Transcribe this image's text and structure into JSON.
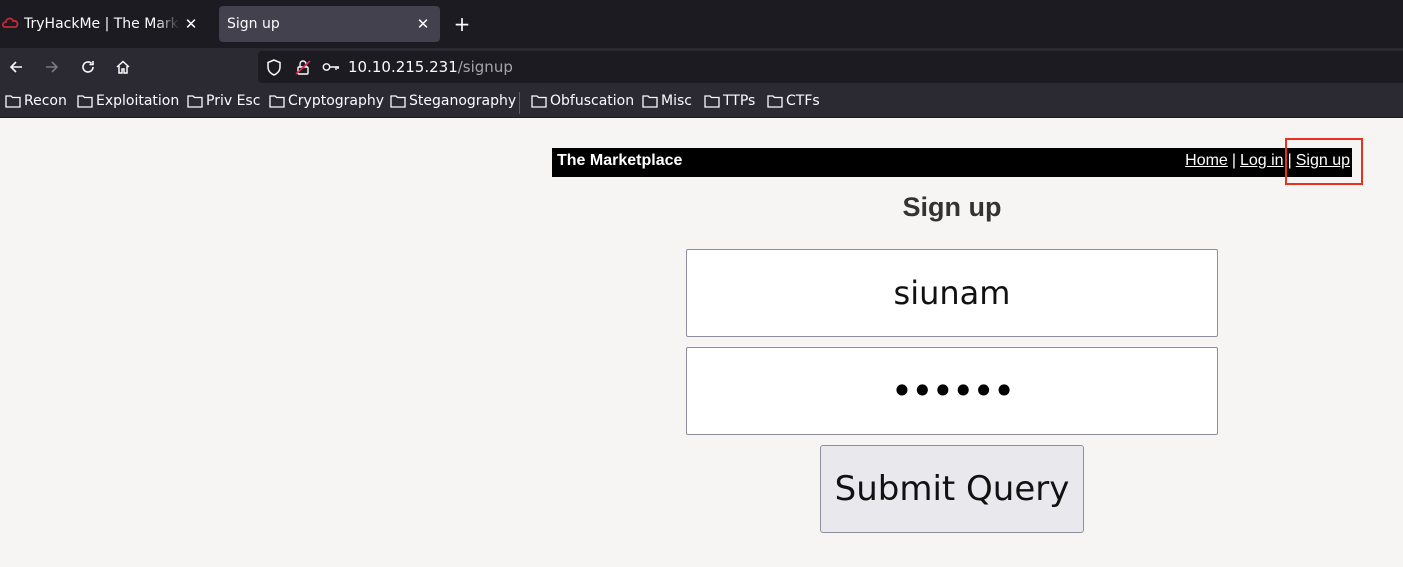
{
  "browser": {
    "tabs": [
      {
        "label": "TryHackMe | The Marketplace",
        "active": false
      },
      {
        "label": "Sign up",
        "active": true
      }
    ],
    "new_tab_label": "+",
    "close_label": "✕",
    "url": {
      "host": "10.10.215.231",
      "path": "/signup"
    },
    "bookmarks": [
      "Recon",
      "Exploitation",
      "Priv Esc",
      "Cryptography",
      "Steganography",
      "Obfuscation",
      "Misc",
      "TTPs",
      "CTFs"
    ]
  },
  "site": {
    "title": "The Marketplace",
    "nav": {
      "home": "Home",
      "login": "Log in",
      "signup": "Sign up",
      "separator": "|"
    },
    "heading": "Sign up"
  },
  "form": {
    "username_value": "siunam",
    "password_value": "••••••",
    "submit_label": "Submit Query"
  },
  "colors": {
    "highlight": "#e8321e",
    "tabbar": "#1c1b22",
    "toolbar": "#2b2a33"
  }
}
